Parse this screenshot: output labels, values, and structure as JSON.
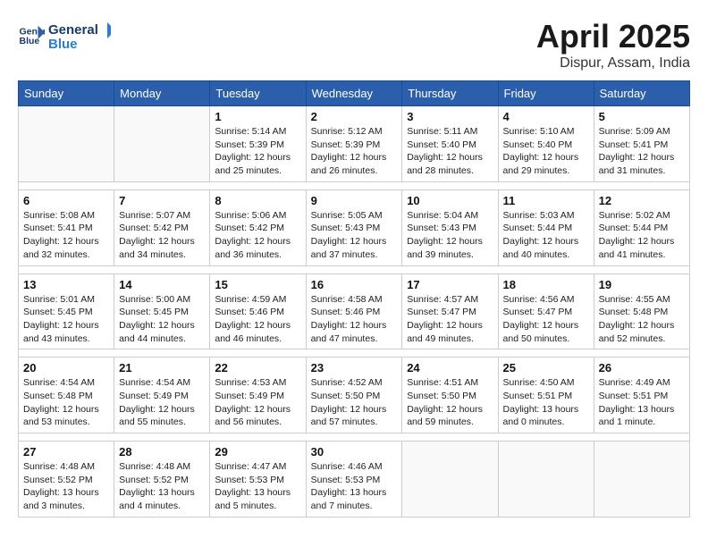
{
  "header": {
    "logo_line1": "General",
    "logo_line2": "Blue",
    "month_title": "April 2025",
    "location": "Dispur, Assam, India"
  },
  "days_of_week": [
    "Sunday",
    "Monday",
    "Tuesday",
    "Wednesday",
    "Thursday",
    "Friday",
    "Saturday"
  ],
  "weeks": [
    [
      {
        "day": "",
        "info": ""
      },
      {
        "day": "",
        "info": ""
      },
      {
        "day": "1",
        "info": "Sunrise: 5:14 AM\nSunset: 5:39 PM\nDaylight: 12 hours and 25 minutes."
      },
      {
        "day": "2",
        "info": "Sunrise: 5:12 AM\nSunset: 5:39 PM\nDaylight: 12 hours and 26 minutes."
      },
      {
        "day": "3",
        "info": "Sunrise: 5:11 AM\nSunset: 5:40 PM\nDaylight: 12 hours and 28 minutes."
      },
      {
        "day": "4",
        "info": "Sunrise: 5:10 AM\nSunset: 5:40 PM\nDaylight: 12 hours and 29 minutes."
      },
      {
        "day": "5",
        "info": "Sunrise: 5:09 AM\nSunset: 5:41 PM\nDaylight: 12 hours and 31 minutes."
      }
    ],
    [
      {
        "day": "6",
        "info": "Sunrise: 5:08 AM\nSunset: 5:41 PM\nDaylight: 12 hours and 32 minutes."
      },
      {
        "day": "7",
        "info": "Sunrise: 5:07 AM\nSunset: 5:42 PM\nDaylight: 12 hours and 34 minutes."
      },
      {
        "day": "8",
        "info": "Sunrise: 5:06 AM\nSunset: 5:42 PM\nDaylight: 12 hours and 36 minutes."
      },
      {
        "day": "9",
        "info": "Sunrise: 5:05 AM\nSunset: 5:43 PM\nDaylight: 12 hours and 37 minutes."
      },
      {
        "day": "10",
        "info": "Sunrise: 5:04 AM\nSunset: 5:43 PM\nDaylight: 12 hours and 39 minutes."
      },
      {
        "day": "11",
        "info": "Sunrise: 5:03 AM\nSunset: 5:44 PM\nDaylight: 12 hours and 40 minutes."
      },
      {
        "day": "12",
        "info": "Sunrise: 5:02 AM\nSunset: 5:44 PM\nDaylight: 12 hours and 41 minutes."
      }
    ],
    [
      {
        "day": "13",
        "info": "Sunrise: 5:01 AM\nSunset: 5:45 PM\nDaylight: 12 hours and 43 minutes."
      },
      {
        "day": "14",
        "info": "Sunrise: 5:00 AM\nSunset: 5:45 PM\nDaylight: 12 hours and 44 minutes."
      },
      {
        "day": "15",
        "info": "Sunrise: 4:59 AM\nSunset: 5:46 PM\nDaylight: 12 hours and 46 minutes."
      },
      {
        "day": "16",
        "info": "Sunrise: 4:58 AM\nSunset: 5:46 PM\nDaylight: 12 hours and 47 minutes."
      },
      {
        "day": "17",
        "info": "Sunrise: 4:57 AM\nSunset: 5:47 PM\nDaylight: 12 hours and 49 minutes."
      },
      {
        "day": "18",
        "info": "Sunrise: 4:56 AM\nSunset: 5:47 PM\nDaylight: 12 hours and 50 minutes."
      },
      {
        "day": "19",
        "info": "Sunrise: 4:55 AM\nSunset: 5:48 PM\nDaylight: 12 hours and 52 minutes."
      }
    ],
    [
      {
        "day": "20",
        "info": "Sunrise: 4:54 AM\nSunset: 5:48 PM\nDaylight: 12 hours and 53 minutes."
      },
      {
        "day": "21",
        "info": "Sunrise: 4:54 AM\nSunset: 5:49 PM\nDaylight: 12 hours and 55 minutes."
      },
      {
        "day": "22",
        "info": "Sunrise: 4:53 AM\nSunset: 5:49 PM\nDaylight: 12 hours and 56 minutes."
      },
      {
        "day": "23",
        "info": "Sunrise: 4:52 AM\nSunset: 5:50 PM\nDaylight: 12 hours and 57 minutes."
      },
      {
        "day": "24",
        "info": "Sunrise: 4:51 AM\nSunset: 5:50 PM\nDaylight: 12 hours and 59 minutes."
      },
      {
        "day": "25",
        "info": "Sunrise: 4:50 AM\nSunset: 5:51 PM\nDaylight: 13 hours and 0 minutes."
      },
      {
        "day": "26",
        "info": "Sunrise: 4:49 AM\nSunset: 5:51 PM\nDaylight: 13 hours and 1 minute."
      }
    ],
    [
      {
        "day": "27",
        "info": "Sunrise: 4:48 AM\nSunset: 5:52 PM\nDaylight: 13 hours and 3 minutes."
      },
      {
        "day": "28",
        "info": "Sunrise: 4:48 AM\nSunset: 5:52 PM\nDaylight: 13 hours and 4 minutes."
      },
      {
        "day": "29",
        "info": "Sunrise: 4:47 AM\nSunset: 5:53 PM\nDaylight: 13 hours and 5 minutes."
      },
      {
        "day": "30",
        "info": "Sunrise: 4:46 AM\nSunset: 5:53 PM\nDaylight: 13 hours and 7 minutes."
      },
      {
        "day": "",
        "info": ""
      },
      {
        "day": "",
        "info": ""
      },
      {
        "day": "",
        "info": ""
      }
    ]
  ]
}
